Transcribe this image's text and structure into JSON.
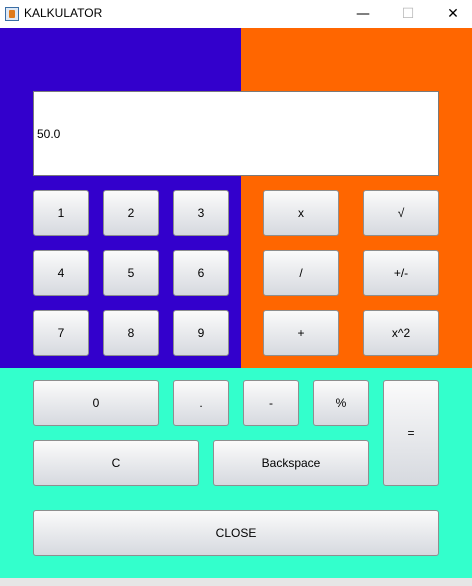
{
  "window": {
    "title": "KALKULATOR",
    "min_glyph": "—",
    "max_glyph": "☐",
    "close_glyph": "✕"
  },
  "display": {
    "value": "50.0"
  },
  "buttons": {
    "n1": "1",
    "n2": "2",
    "n3": "3",
    "n4": "4",
    "n5": "5",
    "n6": "6",
    "n7": "7",
    "n8": "8",
    "n9": "9",
    "n0": "0",
    "multiply": "x",
    "sqrt": "√",
    "divide": "/",
    "negate": "+/-",
    "plus": "+",
    "square": "x^2",
    "dot": ".",
    "minus": "-",
    "percent": "%",
    "equals": "=",
    "clear": "C",
    "backspace": "Backspace",
    "close": "CLOSE"
  },
  "colors": {
    "left_panel": "#3300cc",
    "right_panel": "#ff6600",
    "bottom_panel": "#33ffcc"
  }
}
